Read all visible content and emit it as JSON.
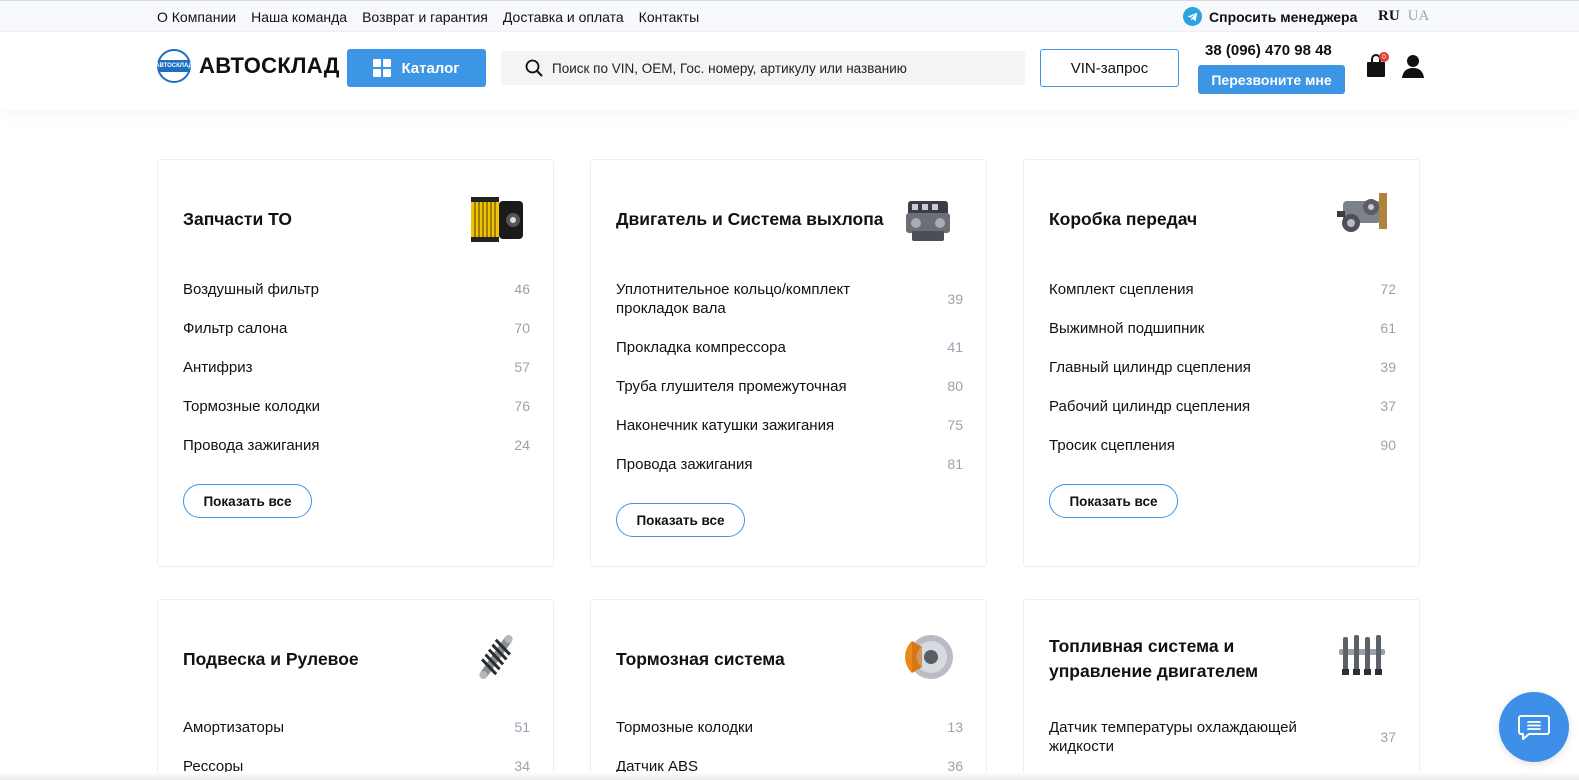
{
  "topbar": {
    "nav": [
      "О Компании",
      "Наша команда",
      "Возврат и гарантия",
      "Доставка и оплата",
      "Контакты"
    ],
    "ask_manager": "Спросить менеджера",
    "lang_active": "RU",
    "lang_other": "UA"
  },
  "header": {
    "logo_text": "АВТОСКЛАД",
    "logo_badge": "АВТОСКЛАД",
    "catalog_label": "Каталог",
    "search_placeholder": "Поиск по VIN, OEM, Гос. номеру, артикулу или названию",
    "vin_label": "VIN-запрос",
    "phone": "38 (096) 470 98 48",
    "callback_label": "Перезвоните мне",
    "cart_count": "0"
  },
  "cards": [
    {
      "title": "Запчасти ТО",
      "items": [
        {
          "label": "Воздушный фильтр",
          "count": "46"
        },
        {
          "label": "Фильтр салона",
          "count": "70"
        },
        {
          "label": "Антифриз",
          "count": "57"
        },
        {
          "label": "Тормозные колодки",
          "count": "76"
        },
        {
          "label": "Провода зажигания",
          "count": "24"
        }
      ],
      "show_all": "Показать все"
    },
    {
      "title": "Двигатель и Система выхлопа",
      "items": [
        {
          "label": "Уплотнительное кольцо/комплект прокладок вала",
          "count": "39"
        },
        {
          "label": "Прокладка компрессора",
          "count": "41"
        },
        {
          "label": "Труба глушителя промежуточная",
          "count": "80"
        },
        {
          "label": "Наконечник катушки зажигания",
          "count": "75"
        },
        {
          "label": "Провода зажигания",
          "count": "81"
        }
      ],
      "show_all": "Показать все"
    },
    {
      "title": "Коробка передач",
      "items": [
        {
          "label": "Комплект сцепления",
          "count": "72"
        },
        {
          "label": "Выжимной подшипник",
          "count": "61"
        },
        {
          "label": "Главный цилиндр сцепления",
          "count": "39"
        },
        {
          "label": "Рабочий цилиндр сцепления",
          "count": "37"
        },
        {
          "label": "Тросик сцепления",
          "count": "90"
        }
      ],
      "show_all": "Показать все"
    },
    {
      "title": "Подвеска и Рулевое",
      "items": [
        {
          "label": "Амортизаторы",
          "count": "51"
        },
        {
          "label": "Рессоры",
          "count": "34"
        }
      ]
    },
    {
      "title": "Тормозная система",
      "items": [
        {
          "label": "Тормозные колодки",
          "count": "13"
        },
        {
          "label": "Датчик ABS",
          "count": "36"
        }
      ]
    },
    {
      "title": "Топливная система и управление двигателем",
      "items": [
        {
          "label": "Датчик температуры охлаждающей жидкости",
          "count": "37"
        }
      ]
    }
  ]
}
